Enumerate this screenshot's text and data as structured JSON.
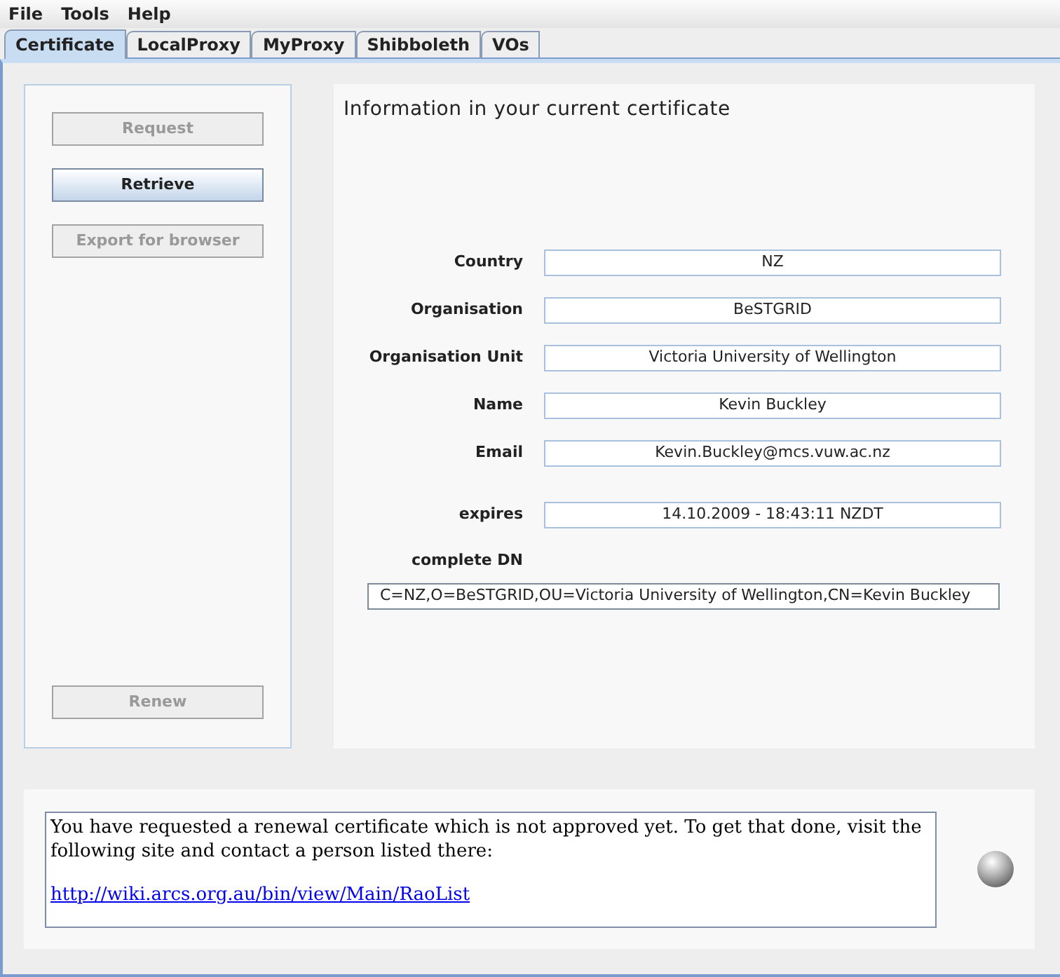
{
  "menu_bar": [
    "File",
    "Tools",
    "Help"
  ],
  "tabs": [
    {
      "label": "Certificate",
      "selected": true
    },
    {
      "label": "LocalProxy",
      "selected": false
    },
    {
      "label": "MyProxy",
      "selected": false
    },
    {
      "label": "Shibboleth",
      "selected": false
    },
    {
      "label": "VOs",
      "selected": false
    }
  ],
  "actions": [
    {
      "label": "Request",
      "disabled": true
    },
    {
      "label": "Retrieve",
      "disabled": false
    },
    {
      "label": "Export for browser",
      "disabled": true
    }
  ],
  "renew_button": {
    "label": "Renew",
    "disabled": true
  },
  "info": {
    "title": "Information in your current certificate",
    "fields": [
      {
        "label": "Country",
        "value": "NZ"
      },
      {
        "label": "Organisation",
        "value": "BeSTGRID"
      },
      {
        "label": "Organisation Unit",
        "value": "Victoria University of Wellington"
      },
      {
        "label": "Name",
        "value": "Kevin Buckley"
      },
      {
        "label": "Email",
        "value": "Kevin.Buckley@mcs.vuw.ac.nz"
      }
    ],
    "expiry": {
      "label": "expires",
      "value": "14.10.2009 - 18:43:11 NZDT"
    },
    "dn": {
      "label": "complete DN",
      "value": "C=NZ,O=BeSTGRID,OU=Victoria University of Wellington,CN=Kevin Buckley"
    }
  },
  "message": {
    "text": "You have requested a renewal certificate which is not approved yet. To get that done, visit the following site and contact a person listed there:",
    "link": "http://wiki.arcs.org.au/bin/view/Main/RaoList"
  }
}
